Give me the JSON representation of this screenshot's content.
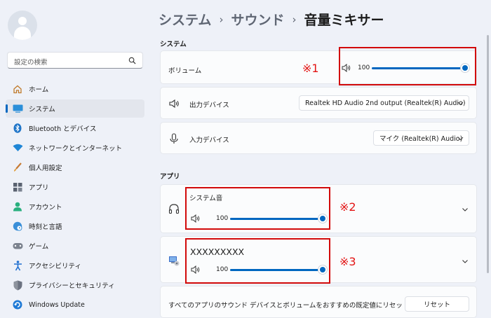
{
  "sidebar": {
    "search_placeholder": "設定の検索",
    "items": [
      {
        "label": "ホーム",
        "icon": "home-icon"
      },
      {
        "label": "システム",
        "icon": "system-icon",
        "active": true
      },
      {
        "label": "Bluetooth とデバイス",
        "icon": "bluetooth-icon"
      },
      {
        "label": "ネットワークとインターネット",
        "icon": "wifi-icon"
      },
      {
        "label": "個人用設定",
        "icon": "brush-icon"
      },
      {
        "label": "アプリ",
        "icon": "apps-icon"
      },
      {
        "label": "アカウント",
        "icon": "account-icon"
      },
      {
        "label": "時刻と言語",
        "icon": "globe-clock-icon"
      },
      {
        "label": "ゲーム",
        "icon": "gamepad-icon"
      },
      {
        "label": "アクセシビリティ",
        "icon": "accessibility-icon"
      },
      {
        "label": "プライバシーとセキュリティ",
        "icon": "shield-icon"
      },
      {
        "label": "Windows Update",
        "icon": "windows-update-icon"
      }
    ]
  },
  "breadcrumb": {
    "items": [
      "システム",
      "サウンド"
    ],
    "current": "音量ミキサー",
    "separator": "›"
  },
  "system_section": {
    "title": "システム",
    "volume": {
      "label": "ボリューム",
      "value": "100",
      "level": 1.0
    },
    "output": {
      "label": "出力デバイス",
      "selected": "Realtek HD Audio 2nd output (Realtek(R) Audio)"
    },
    "input": {
      "label": "入力デバイス",
      "selected": "マイク (Realtek(R) Audio)"
    }
  },
  "apps_section": {
    "title": "アプリ",
    "apps": [
      {
        "name": "システム音",
        "value": "100",
        "level": 1.0,
        "icon": "headphones-icon"
      },
      {
        "name": "XXXXXXXXX",
        "value": "100",
        "level": 1.0,
        "icon": "app-icon"
      }
    ],
    "reset_text": "すべてのアプリのサウンド デバイスとボリュームをおすすめの既定値にリセットする",
    "reset_button": "リセット"
  },
  "annotations": {
    "note1": "※1",
    "note2": "※2",
    "note3": "※3",
    "box_color": "#d20a0a"
  },
  "colors": {
    "accent": "#0067c0",
    "background": "#eef1f8",
    "card": "#fbfcfd"
  }
}
